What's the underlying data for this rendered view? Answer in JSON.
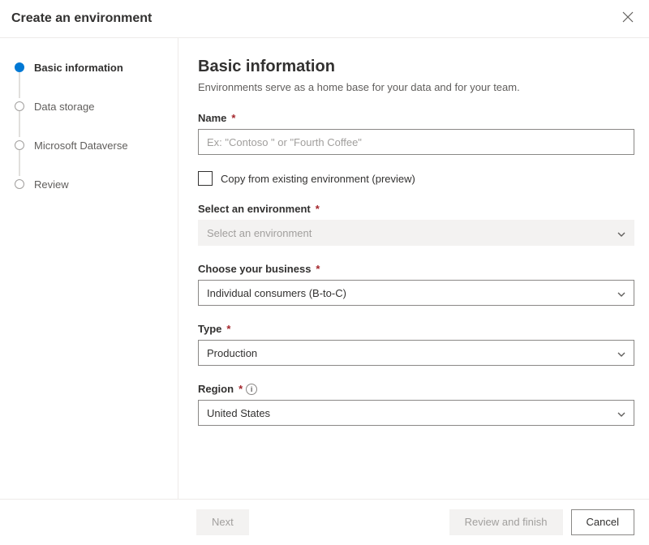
{
  "header": {
    "title": "Create an environment"
  },
  "stepper": {
    "steps": [
      {
        "label": "Basic information",
        "active": true
      },
      {
        "label": "Data storage",
        "active": false
      },
      {
        "label": "Microsoft Dataverse",
        "active": false
      },
      {
        "label": "Review",
        "active": false
      }
    ]
  },
  "main": {
    "heading": "Basic information",
    "subtitle": "Environments serve as a home base for your data and for your team.",
    "name": {
      "label": "Name",
      "placeholder": "Ex: \"Contoso \" or \"Fourth Coffee\""
    },
    "copy": {
      "label": "Copy from existing environment (preview)",
      "checked": false
    },
    "selectEnv": {
      "label": "Select an environment",
      "placeholder": "Select an environment"
    },
    "business": {
      "label": "Choose your business",
      "value": "Individual consumers (B-to-C)"
    },
    "type": {
      "label": "Type",
      "value": "Production"
    },
    "region": {
      "label": "Region",
      "value": "United States"
    }
  },
  "footer": {
    "next": "Next",
    "review": "Review and finish",
    "cancel": "Cancel"
  }
}
